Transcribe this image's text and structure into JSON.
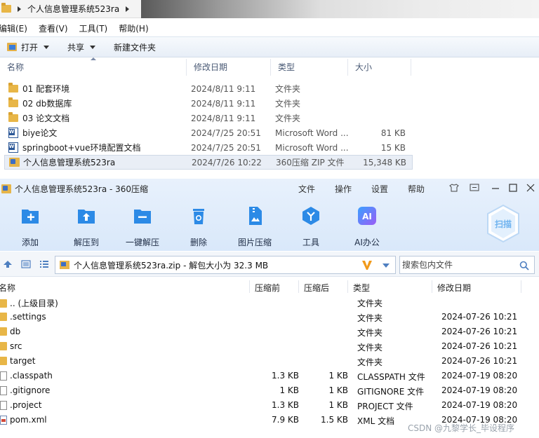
{
  "explorer": {
    "path": "个人信息管理系统523ra",
    "menu": [
      "编辑(E)",
      "查看(V)",
      "工具(T)",
      "帮助(H)"
    ],
    "toolbar": {
      "open": "打开",
      "share": "共享",
      "new_folder": "新建文件夹"
    },
    "columns": {
      "name": "名称",
      "date": "修改日期",
      "type": "类型",
      "size": "大小"
    },
    "rows": [
      {
        "name": "01 配套环境",
        "date": "2024/8/11 9:11",
        "type": "文件夹",
        "size": "",
        "icon": "folder-icon"
      },
      {
        "name": "02 db数据库",
        "date": "2024/8/11 9:11",
        "type": "文件夹",
        "size": "",
        "icon": "folder-icon"
      },
      {
        "name": "03 论文文档",
        "date": "2024/8/11 9:11",
        "type": "文件夹",
        "size": "",
        "icon": "folder-icon"
      },
      {
        "name": "biye论文",
        "date": "2024/7/25 20:51",
        "type": "Microsoft Word ...",
        "size": "81 KB",
        "icon": "word-document-icon"
      },
      {
        "name": "springboot+vue环境配置文档",
        "date": "2024/7/25 20:51",
        "type": "Microsoft Word ...",
        "size": "15 KB",
        "icon": "word-document-icon"
      },
      {
        "name": "个人信息管理系统523ra",
        "date": "2024/7/26 10:22",
        "type": "360压缩 ZIP 文件",
        "size": "15,348 KB",
        "icon": "zip-archive-icon"
      }
    ]
  },
  "zip": {
    "title": "个人信息管理系统523ra - 360压缩",
    "menu": [
      "文件",
      "操作",
      "设置",
      "帮助"
    ],
    "tools": [
      {
        "label": "添加",
        "icon": "add-icon"
      },
      {
        "label": "解压到",
        "icon": "extract-to-icon"
      },
      {
        "label": "一键解压",
        "icon": "one-click-extract-icon"
      },
      {
        "label": "删除",
        "icon": "delete-icon"
      },
      {
        "label": "图片压缩",
        "icon": "image-compress-icon"
      },
      {
        "label": "工具",
        "icon": "tools-icon"
      },
      {
        "label": "AI办公",
        "icon": "ai-office-icon"
      }
    ],
    "scan_label": "扫描",
    "address": "个人信息管理系统523ra.zip - 解包大小为 32.3 MB",
    "search_placeholder": "搜索包内文件",
    "columns": {
      "name": "名称",
      "compressed_before": "压缩前",
      "compressed_after": "压缩后",
      "type": "类型",
      "date": "修改日期"
    },
    "rows": [
      {
        "name": ".. (上级目录)",
        "before": "",
        "after": "",
        "type": "文件夹",
        "date": "",
        "icon": "folder-icon"
      },
      {
        "name": ".settings",
        "before": "",
        "after": "",
        "type": "文件夹",
        "date": "2024-07-26 10:21",
        "icon": "folder-icon"
      },
      {
        "name": "db",
        "before": "",
        "after": "",
        "type": "文件夹",
        "date": "2024-07-26 10:21",
        "icon": "folder-icon"
      },
      {
        "name": "src",
        "before": "",
        "after": "",
        "type": "文件夹",
        "date": "2024-07-26 10:21",
        "icon": "folder-icon"
      },
      {
        "name": "target",
        "before": "",
        "after": "",
        "type": "文件夹",
        "date": "2024-07-26 10:21",
        "icon": "folder-icon"
      },
      {
        "name": ".classpath",
        "before": "1.3 KB",
        "after": "1 KB",
        "type": "CLASSPATH 文件",
        "date": "2024-07-19 08:20",
        "icon": "file-icon"
      },
      {
        "name": ".gitignore",
        "before": "1 KB",
        "after": "1 KB",
        "type": "GITIGNORE 文件",
        "date": "2024-07-19 08:20",
        "icon": "file-icon"
      },
      {
        "name": ".project",
        "before": "1.3 KB",
        "after": "1 KB",
        "type": "PROJECT 文件",
        "date": "2024-07-19 08:20",
        "icon": "file-icon"
      },
      {
        "name": "pom.xml",
        "before": "7.9 KB",
        "after": "1.5 KB",
        "type": "XML 文档",
        "date": "2024-07-19 08:20",
        "icon": "xml-file-icon"
      }
    ]
  },
  "watermark": "CSDN @九黎学长_毕设程序"
}
